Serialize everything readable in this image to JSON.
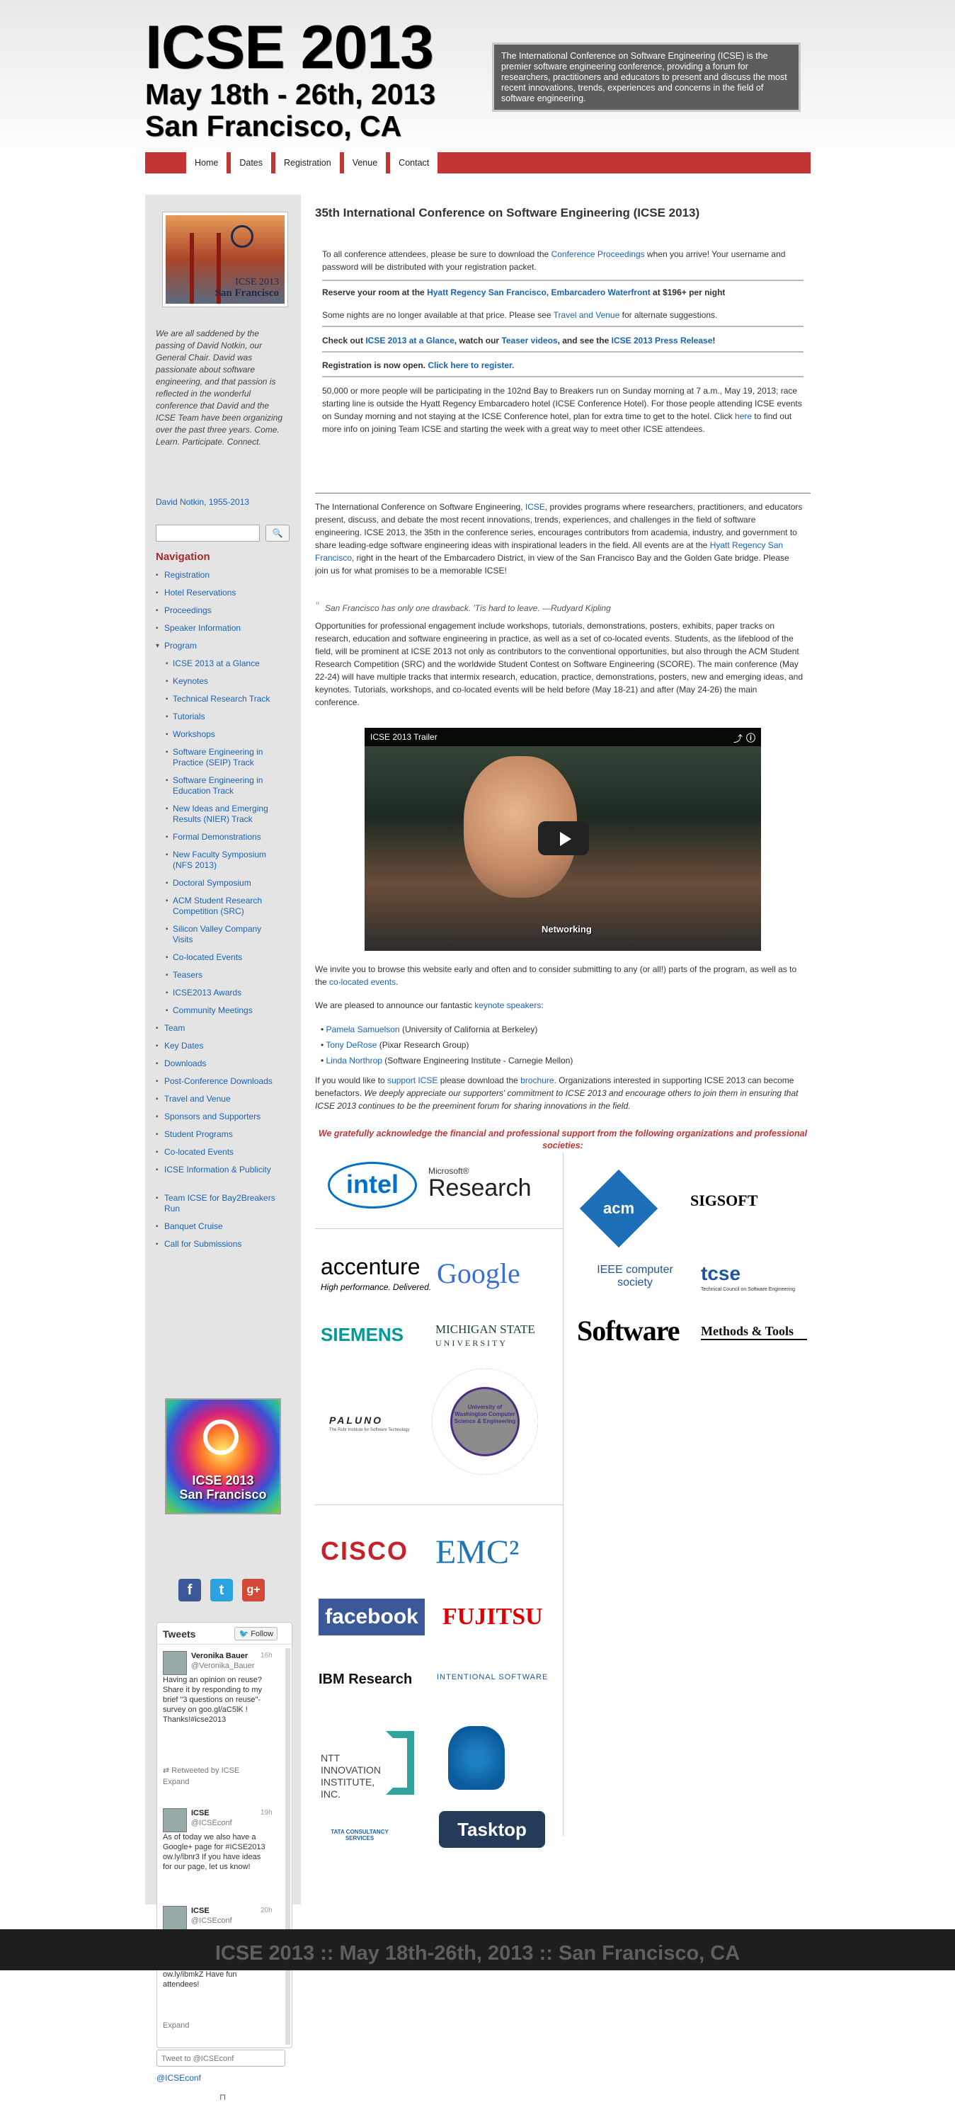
{
  "header": {
    "title": "ICSE 2013",
    "dates": "May 18th - 26th, 2013",
    "location": "San Francisco, CA",
    "intro": "The International Conference on Software Engineering (ICSE) is the premier software engineering conference, providing a forum for researchers, practitioners and educators to present and discuss the most recent innovations, trends, experiences and concerns in the field of software engineering."
  },
  "nav": [
    "Home",
    "Dates",
    "Registration",
    "Venue",
    "Contact"
  ],
  "sidebar": {
    "logo_line1": "ICSE 2013",
    "logo_line2": "San Francisco",
    "memorial": "We are all saddened by the passing of David Notkin, our General Chair. David was passionate about software engineering, and that passion is reflected in the wonderful conference that David and the ICSE Team have been organizing over the past three years. Come. Learn. Participate. Connect.",
    "notkin_link": "David Notkin, 1955-2013",
    "search_button": "🔍",
    "nav_heading": "Navigation",
    "nav_items": [
      {
        "label": "Registration",
        "level": 0,
        "bullet": "▪"
      },
      {
        "label": "Hotel Reservations",
        "level": 0,
        "bullet": "▪"
      },
      {
        "label": "Proceedings",
        "level": 0,
        "bullet": "▪"
      },
      {
        "label": "Speaker Information",
        "level": 0,
        "bullet": "▪"
      },
      {
        "label": "Program",
        "level": 0,
        "bullet": "▾"
      },
      {
        "label": "ICSE 2013 at a Glance",
        "level": 1,
        "bullet": "▪"
      },
      {
        "label": "Keynotes",
        "level": 1,
        "bullet": "▪"
      },
      {
        "label": "Technical Research Track",
        "level": 1,
        "bullet": "▪"
      },
      {
        "label": "Tutorials",
        "level": 1,
        "bullet": "▪"
      },
      {
        "label": "Workshops",
        "level": 1,
        "bullet": "▪"
      },
      {
        "label": "Software Engineering in Practice (SEIP) Track",
        "level": 1,
        "bullet": "▪"
      },
      {
        "label": "Software Engineering in Education Track",
        "level": 1,
        "bullet": "▪"
      },
      {
        "label": "New Ideas and Emerging Results (NIER) Track",
        "level": 1,
        "bullet": "▪"
      },
      {
        "label": "Formal Demonstrations",
        "level": 1,
        "bullet": "▪"
      },
      {
        "label": "New Faculty Symposium (NFS 2013)",
        "level": 1,
        "bullet": "▪"
      },
      {
        "label": "Doctoral Symposium",
        "level": 1,
        "bullet": "▪"
      },
      {
        "label": "ACM Student Research Competition (SRC)",
        "level": 1,
        "bullet": "▪"
      },
      {
        "label": "Silicon Valley Company Visits",
        "level": 1,
        "bullet": "▪"
      },
      {
        "label": "Co-located Events",
        "level": 1,
        "bullet": "▪"
      },
      {
        "label": "Teasers",
        "level": 1,
        "bullet": "▪"
      },
      {
        "label": "ICSE2013 Awards",
        "level": 1,
        "bullet": "▪"
      },
      {
        "label": "Community Meetings",
        "level": 1,
        "bullet": "▪"
      },
      {
        "label": "Team",
        "level": 0,
        "bullet": "▪"
      },
      {
        "label": "Key Dates",
        "level": 0,
        "bullet": "▪"
      },
      {
        "label": "Downloads",
        "level": 0,
        "bullet": "▪"
      },
      {
        "label": "Post-Conference Downloads",
        "level": 0,
        "bullet": "▪"
      },
      {
        "label": "Travel and Venue",
        "level": 0,
        "bullet": "▪"
      },
      {
        "label": "Sponsors and Supporters",
        "level": 0,
        "bullet": "▪"
      },
      {
        "label": "Student Programs",
        "level": 0,
        "bullet": "▪"
      },
      {
        "label": "Co-located Events",
        "level": 0,
        "bullet": "▪"
      },
      {
        "label": "ICSE Information & Publicity",
        "level": 0,
        "bullet": "▪"
      },
      {
        "label": "Team ICSE for Bay2Breakers Run",
        "level": 0,
        "bullet": "▪"
      },
      {
        "label": "Banquet Cruise",
        "level": 0,
        "bullet": "▪"
      },
      {
        "label": "Call for Submissions",
        "level": 0,
        "bullet": "▪"
      }
    ],
    "badge_line1": "ICSE 2013",
    "badge_line2": "San Francisco",
    "social": [
      {
        "icon": "facebook-icon",
        "glyph": "f",
        "color": "#3b5998"
      },
      {
        "icon": "twitter-icon",
        "glyph": "t",
        "color": "#2aa3de"
      },
      {
        "icon": "google-plus-icon",
        "glyph": "g+",
        "color": "#d34836"
      }
    ],
    "tweets_title": "Tweets",
    "follow_label": "🐦 Follow",
    "tweets": [
      {
        "name": "Veronika Bauer",
        "handle": "@Veronika_Bauer",
        "time": "16h",
        "body": "Having an opinion on reuse? Share it by responding to my brief \"3 questions on reuse\"-survey on goo.gl/aC5lK ! Thanks!#icse2013",
        "meta": "⇄ Retweeted by ICSE",
        "expand": "Expand"
      },
      {
        "name": "ICSE",
        "handle": "@ICSEconf",
        "time": "19h",
        "body": "As of today we also have a Google+ page for #ICSE2013 ow.ly/ibnr3 If you have ideas for our page, let us know!",
        "meta": "",
        "expand": ""
      },
      {
        "name": "ICSE",
        "handle": "@ICSEconf",
        "time": "20h",
        "body": "ICSE Workshop today: #AST2013, #MiSE13, ASSURE (hash tag unknown), #IWSC13 and #LIVE2013 ow.ly/ibmkZ Have fun attendees!",
        "meta": "",
        "expand": "Expand"
      }
    ],
    "compose_placeholder": "Tweet to @ICSEconf",
    "twitter_link": "@ICSEconf",
    "end_mark": "⊓"
  },
  "main": {
    "title": "35th International Conference on Software Engineering (ICSE 2013)",
    "proceedings_pre": "To all conference attendees, please be sure to download the ",
    "proceedings_link": "Conference Proceedings",
    "proceedings_post": " when you arrive! Your username and password will be distributed with your registration packet.",
    "hotel_pre": "Reserve your room at the ",
    "hotel_link": "Hyatt Regency San Francisco, Embarcadero Waterfront",
    "hotel_post": " at $196+ per night",
    "hotel_note_pre": "Some nights are no longer available at that price. Please see ",
    "hotel_note_link": "Travel and Venue",
    "hotel_note_post": " for alternate suggestions.",
    "glance_pre": "Check out ",
    "glance_link1": "ICSE 2013 at a Glance",
    "glance_mid1": ", watch our ",
    "glance_link2": "Teaser videos",
    "glance_mid2": ", and see the ",
    "glance_link3": "ICSE 2013 Press Release",
    "glance_post": "!",
    "reg_pre": "Registration is now open. ",
    "reg_link": "Click here to register.",
    "b2b": "50,000 or more people will be participating in the 102nd Bay to Breakers run on Sunday morning at 7 a.m., May 19, 2013; race starting line is outside the Hyatt Regency Embarcadero hotel (ICSE Conference Hotel). For those people attending ICSE events on Sunday morning and not staying at the ICSE Conference hotel, plan for extra time to get to the hotel. Click ",
    "b2b_link": "here",
    "b2b_post": " to find out more info on joining Team ICSE and starting the week with a great way to meet other ICSE attendees.",
    "intro_pre": "The International Conference on Software Engineering, ",
    "intro_link1": "ICSE",
    "intro_mid": ", provides programs where researchers, practitioners, and educators present, discuss, and debate the most recent innovations, trends, experiences, and challenges in the field of software engineering. ICSE 2013, the 35th in the conference series, encourages contributors from academia, industry, and government to share leading-edge software engineering ideas with inspirational leaders in the field.  All events are at the ",
    "intro_link2": "Hyatt Regency San Francisco",
    "intro_post": ", right in the heart of the Embarcadero District, in view of the San Francisco Bay and the Golden Gate bridge.  Please join us for what promises to be a memorable ICSE!",
    "quote": "San Francisco has only one drawback. 'Tis hard to leave. —Rudyard Kipling",
    "opportunities": "Opportunities for professional engagement include workshops, tutorials, demonstrations, posters, exhibits, paper tracks on research, education and software engineering in practice, as well as a set of co-located events.  Students, as the lifeblood of the field, will be prominent at ICSE 2013 not only as contributors to the conventional opportunities, but also through the ACM Student Research Competition (SRC) and the worldwide Student Contest on Software Engineering (SCORE).  The main conference (May 22-24) will have multiple tracks that intermix research, education, practice, demonstrations, posters, new and emerging ideas, and keynotes. Tutorials, workshops, and co-located events will be held before (May 18-21) and after (May 24-26) the main conference.",
    "video_title": "ICSE 2013 Trailer",
    "video_caption": "Networking",
    "invite_pre": "We invite you to browse this website early and often and to consider submitting to any (or all!) parts of the program, as well as to the ",
    "invite_link": "co-located events",
    "invite_post": ".",
    "keynote_pre": "We are pleased to announce our fantastic ",
    "keynote_link": "keynote speakers",
    "keynote_post": ":",
    "speakers": [
      {
        "name": "Pamela Samuelson",
        "affil": " (University of California at Berkeley)"
      },
      {
        "name": "Tony DeRose",
        "affil": " (Pixar Research Group)"
      },
      {
        "name": "Linda Northrop",
        "affil": " (Software Engineering Institute - Carnegie Mellon)"
      }
    ],
    "support_pre": "If you would like to ",
    "support_link1": "support ICSE",
    "support_mid": " please download the ",
    "support_link2": "brochure",
    "support_post": ". Organizations interested in supporting ICSE 2013 can become benefactors. ",
    "support_italic": " We deeply appreciate our supporters' commitment to ICSE 2013 and encourage others to join them in ensuring that ICSE 2013 continues to be the preeminent forum for sharing innovations in the field.",
    "ack": "We gratefully acknowledge the financial and professional support from the following organizations and professional societies:"
  },
  "sponsors": {
    "intel": "intel",
    "msr_top": "Microsoft®",
    "msr_bottom": "Research",
    "accenture": "accenture",
    "accenture_tag": "High performance. Delivered.",
    "google": "Google",
    "siemens": "SIEMENS",
    "msu_top": "MICHIGAN STATE",
    "msu_bottom": "UNIVERSITY",
    "paluno": "PALUNO",
    "paluno_sub": "The Ruhr Institute for Software Technology",
    "uw": "University of Washington Computer Science & Engineering",
    "cisco": "CISCO",
    "emc": "EMC²",
    "facebook": "facebook",
    "fujitsu": "FUJITSU",
    "ibm": "IBM Research",
    "intentional": "INTENTIONAL SOFTWARE",
    "ntt": "NTT INNOVATION INSTITUTE, INC.",
    "tata": "TATA CONSULTANCY SERVICES",
    "tasktop": "Tasktop",
    "acm": "acm",
    "sigsoft": "SIGSOFT",
    "ieee": "IEEE computer society",
    "tcse": "tcse",
    "tcse_sub": "Technical Council on Software Engineering",
    "software": "Software",
    "methods": "Methods & Tools"
  },
  "footer": "ICSE 2013 :: May 18th-26th, 2013 :: San Francisco, CA"
}
